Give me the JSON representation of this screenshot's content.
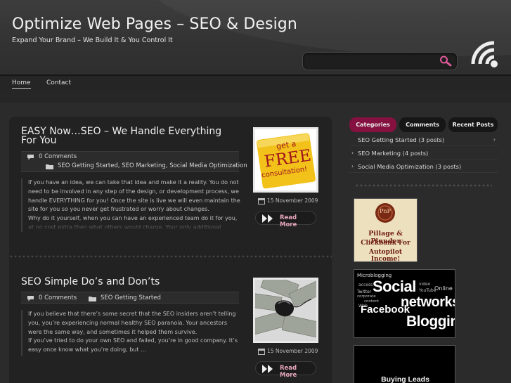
{
  "header": {
    "site_title": "Optimize Web Pages – SEO & Design",
    "tagline": "Expand Your Brand – We Build It & You Control It",
    "search_placeholder": "",
    "search_icon": "magnifier-icon",
    "rss_icon": "rss-icon"
  },
  "nav": {
    "items": [
      {
        "label": "Home",
        "active": true
      },
      {
        "label": "Contact",
        "active": false
      }
    ]
  },
  "posts": [
    {
      "title": "EASY Now…SEO – We Handle Everything For You",
      "comments": "0 Comments",
      "categories": "SEO Getting Started, SEO Marketing, Social Media Optimization",
      "excerpt": "If you have an idea, we can take that idea and make it a reality. You do not need to be involved in any step of the design, or development process, we handle EVERYTHING for you! Once the site is live we will even maintain the site for you so you never get frustrated or worry about changes.\nWhy do it yourself, when you can have an experienced team do it for you, at no cost extra then what others would charge. Your only additional charge will",
      "thumb_text_line1": "get a",
      "thumb_text_line2": "FREE",
      "thumb_text_line3": "consultation!",
      "date": "15 November 2009",
      "more_label": "Read More"
    },
    {
      "title": "SEO Simple Do’s and Don’ts",
      "comments": "0 Comments",
      "categories": "SEO Getting Started",
      "excerpt": "If you believe that there’s some secret that the SEO insiders aren’t telling you, you’re experiencing normal healthy SEO paranoia. Your ancestors were the same way, and sometimes it helped them survive.\nIf you’ve tried to do your own SEO and failed, you’re in good company. It’s easy once know what you’re doing, but …",
      "date": "15 November 2009",
      "more_label": "Read More"
    }
  ],
  "sidebar": {
    "tabs": [
      "Categories",
      "Comments",
      "Recent Posts"
    ],
    "categories": [
      {
        "label": "SEO Getting Started  (3 posts)"
      },
      {
        "label": "SEO Marketing  (4 posts)"
      },
      {
        "label": "Social Media Optimization  (3 posts)"
      }
    ],
    "ads": [
      {
        "seal_text": "PnP",
        "line1": "Pillage & Plunder",
        "line2": "Clickbank For",
        "line3": "Autopilot Income!"
      },
      {
        "words": [
          "Microblogging",
          "Social",
          "networks",
          "Facebook",
          "Blogging",
          "Online",
          "YouTube",
          "video",
          "corporate",
          "Twitter",
          "access",
          "content",
          "Web"
        ]
      },
      {
        "title": "Buying Leads"
      }
    ]
  },
  "colors": {
    "accent": "#84113f",
    "read_more": "#e8a6bd",
    "background": "#2b2b2b"
  }
}
